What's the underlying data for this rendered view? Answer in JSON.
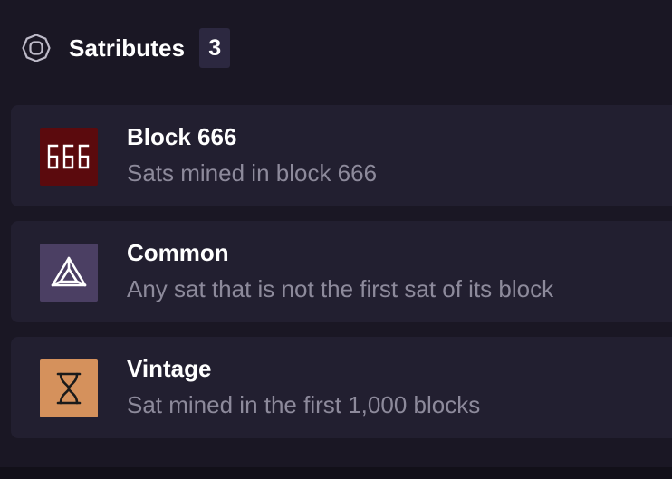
{
  "header": {
    "title": "Satributes",
    "count": "3",
    "icon": "satributes-icon"
  },
  "satributes": [
    {
      "title": "Block 666",
      "description": "Sats mined in block 666",
      "icon": "block-666-icon",
      "icon_text": "666",
      "icon_bg": "#5b0a0d",
      "icon_fg": "#ffffff"
    },
    {
      "title": "Common",
      "description": "Any sat that is not the first sat of its block",
      "icon": "triangle-icon",
      "icon_bg": "#4b3f63",
      "icon_fg": "#ffffff"
    },
    {
      "title": "Vintage",
      "description": "Sat mined in the first 1,000 blocks",
      "icon": "hourglass-icon",
      "icon_bg": "#d5915c",
      "icon_fg": "#1a1a1a"
    }
  ],
  "colors": {
    "background": "#1a1724",
    "card": "#221f30",
    "badge": "#2c2840",
    "title_text": "#ffffff",
    "description_text": "#8d8a9b"
  }
}
